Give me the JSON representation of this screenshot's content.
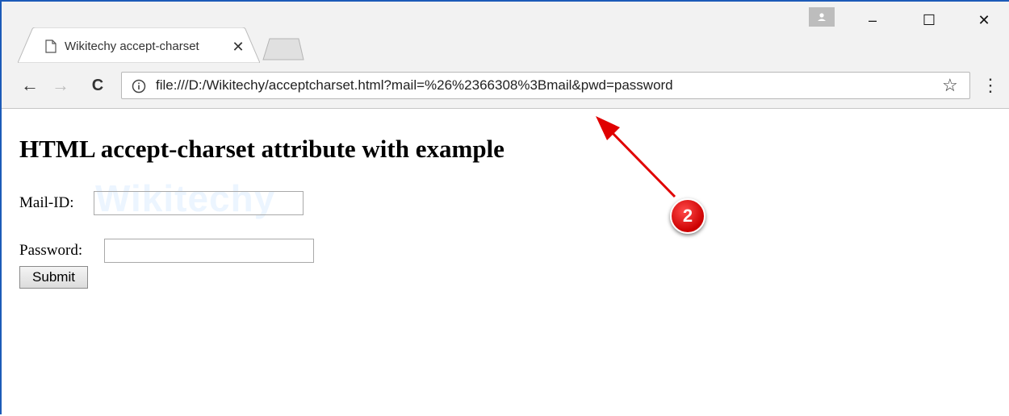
{
  "tab": {
    "title": "Wikitechy accept-charset",
    "close_glyph": "✕"
  },
  "window_controls": {
    "minimize": "–",
    "maximize": "☐",
    "close": "✕"
  },
  "toolbar": {
    "back": "←",
    "forward": "→",
    "reload": "C",
    "url": "file:///D:/Wikitechy/acceptcharset.html?mail=%26%2366308%3Bmail&pwd=password",
    "bookmark": "☆",
    "menu": "⋮"
  },
  "page": {
    "heading": "HTML accept-charset attribute with example",
    "watermark": "Wikitechy",
    "mail_label": "Mail-ID:",
    "mail_value": "",
    "password_label": "Password:",
    "password_value": "",
    "submit_label": "Submit"
  },
  "annotation": {
    "badge": "2",
    "color": "#e00000"
  },
  "icons": [
    "page-icon",
    "info-icon",
    "star-icon",
    "profile-icon",
    "menu-icon"
  ]
}
